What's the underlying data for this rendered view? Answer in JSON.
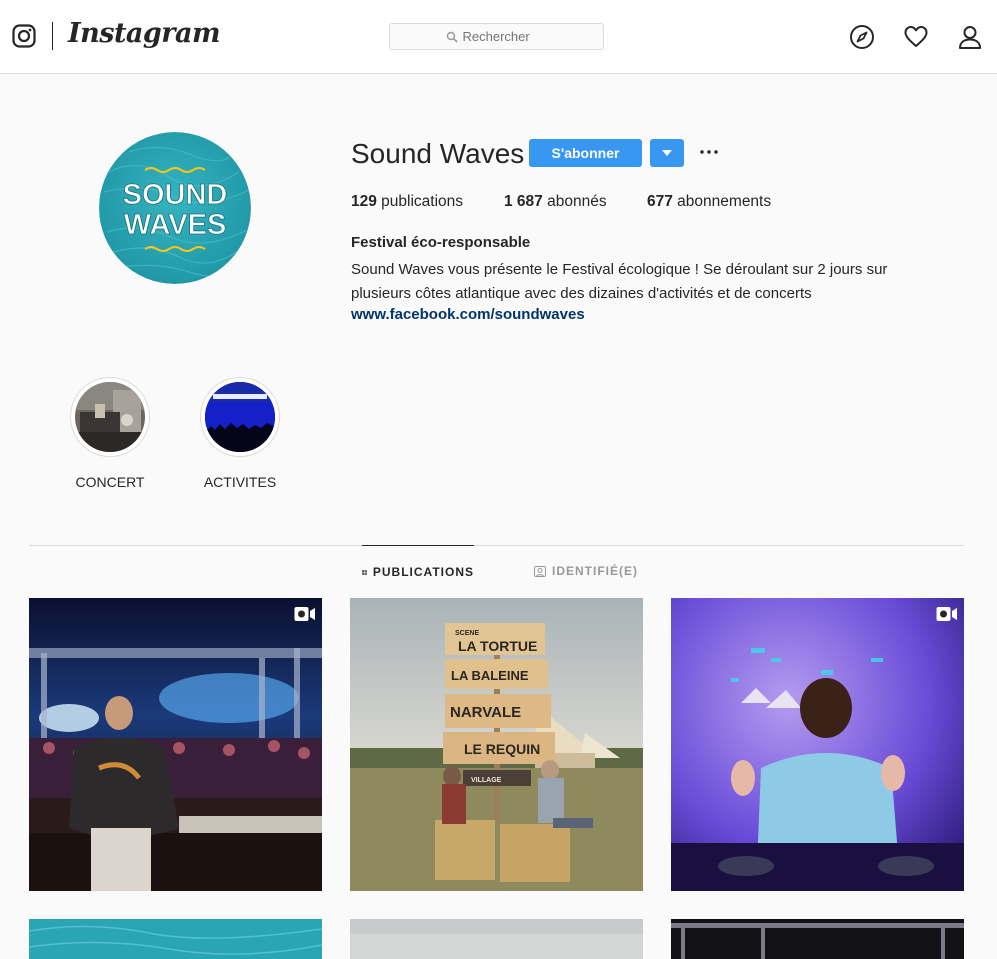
{
  "header": {
    "logo_text": "Instagram",
    "search": {
      "placeholder": "Rechercher"
    },
    "icons": [
      "instagram-glyph-icon",
      "compass-icon",
      "heart-icon",
      "profile-icon"
    ]
  },
  "profile": {
    "username": "Sound Waves",
    "avatar_text": [
      "SOUND",
      "WAVES"
    ],
    "follow_label": "S'abonner",
    "stats": {
      "posts_count": "129",
      "posts_label": " publications",
      "followers_count": "1 687",
      "followers_label": " abonnés",
      "following_count": "677",
      "following_label": " abonnements"
    },
    "bio_title": "Festival éco-responsable",
    "bio_text": "Sound Waves vous présente le Festival écologique ! Se déroulant sur 2 jours sur plusieurs côtes atlantique avec des dizaines d'activités et de concerts",
    "bio_link": "www.facebook.com/soundwaves"
  },
  "highlights": [
    {
      "label": "CONCERT"
    },
    {
      "label": "ACTIVITES"
    }
  ],
  "tabs": [
    {
      "label": "PUBLICATIONS",
      "active": true
    },
    {
      "label": "IDENTIFIÉ(E)",
      "active": false
    }
  ],
  "posts": {
    "signpost": [
      "SCENE",
      "LA TORTUE",
      "LA BALEINE",
      "NARVALE",
      "LE REQUIN",
      "VILLAGE"
    ]
  },
  "colors": {
    "accent": "#3897f0",
    "link": "#003569",
    "avatar_teal": "#2aa5b3"
  }
}
